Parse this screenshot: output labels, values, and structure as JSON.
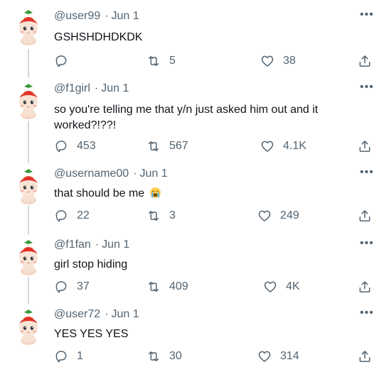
{
  "tweets": [
    {
      "handle": "@user99",
      "date": "Jun 1",
      "text": "GSHSHDHDKDK",
      "emoji": "",
      "replies": "",
      "retweets": "5",
      "likes": "38"
    },
    {
      "handle": "@f1girl",
      "date": "Jun 1",
      "text": "so you're telling me that y/n just asked him out and it worked?!??!",
      "emoji": "",
      "replies": "453",
      "retweets": "567",
      "likes": "4.1K"
    },
    {
      "handle": "@username00",
      "date": "Jun 1",
      "text": "that should be me",
      "emoji": "loudly-crying-face",
      "replies": "22",
      "retweets": "3",
      "likes": "249"
    },
    {
      "handle": "@f1fan",
      "date": "Jun 1",
      "text": "girl stop hiding",
      "emoji": "",
      "replies": "37",
      "retweets": "409",
      "likes": "4K"
    },
    {
      "handle": "@user72",
      "date": "Jun 1",
      "text": "YES YES YES",
      "emoji": "",
      "replies": "1",
      "retweets": "30",
      "likes": "314"
    }
  ],
  "separator": "·",
  "more_label": "•••",
  "icons": {
    "avatar": "strawberry-hat-doll",
    "reply": "reply-icon",
    "retweet": "retweet-icon",
    "like": "heart-icon",
    "share": "share-icon"
  },
  "colors": {
    "text": "#0f1419",
    "muted": "#536471",
    "line": "#cfd9de",
    "strawberry": "#e0342a"
  }
}
